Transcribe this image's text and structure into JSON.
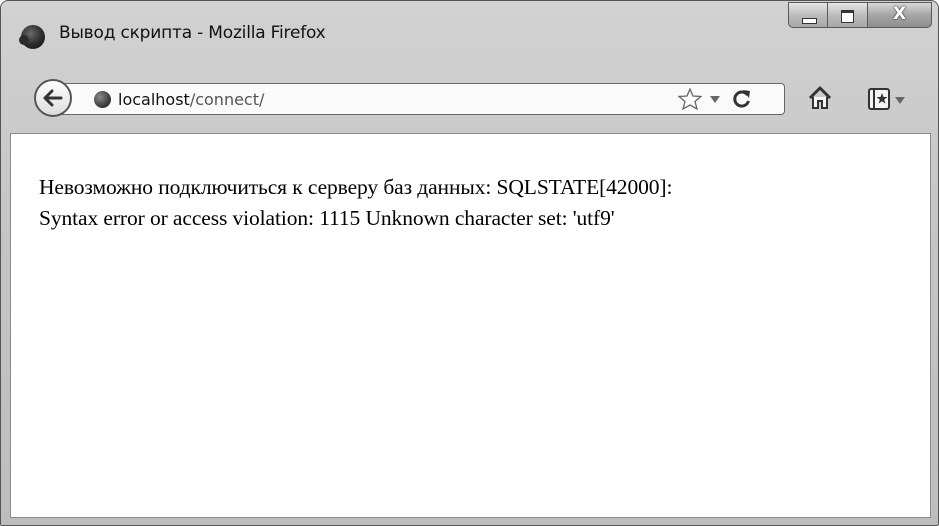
{
  "window": {
    "title": "Вывод скрипта - Mozilla Firefox",
    "close_glyph": "X"
  },
  "toolbar": {
    "url_host": "localhost",
    "url_path": "/connect/"
  },
  "page": {
    "line1": "Невозможно подключиться к серверу баз данных: SQLSTATE[42000]:",
    "line2": "Syntax error or access violation: 1115 Unknown character set: 'utf9'"
  },
  "icons": [
    "firefox-icon",
    "minimize-icon",
    "maximize-icon",
    "close-icon",
    "back-arrow-icon",
    "site-identity-icon",
    "star-icon",
    "dropmarker-icon",
    "reload-icon",
    "home-icon",
    "bookmarks-icon"
  ]
}
